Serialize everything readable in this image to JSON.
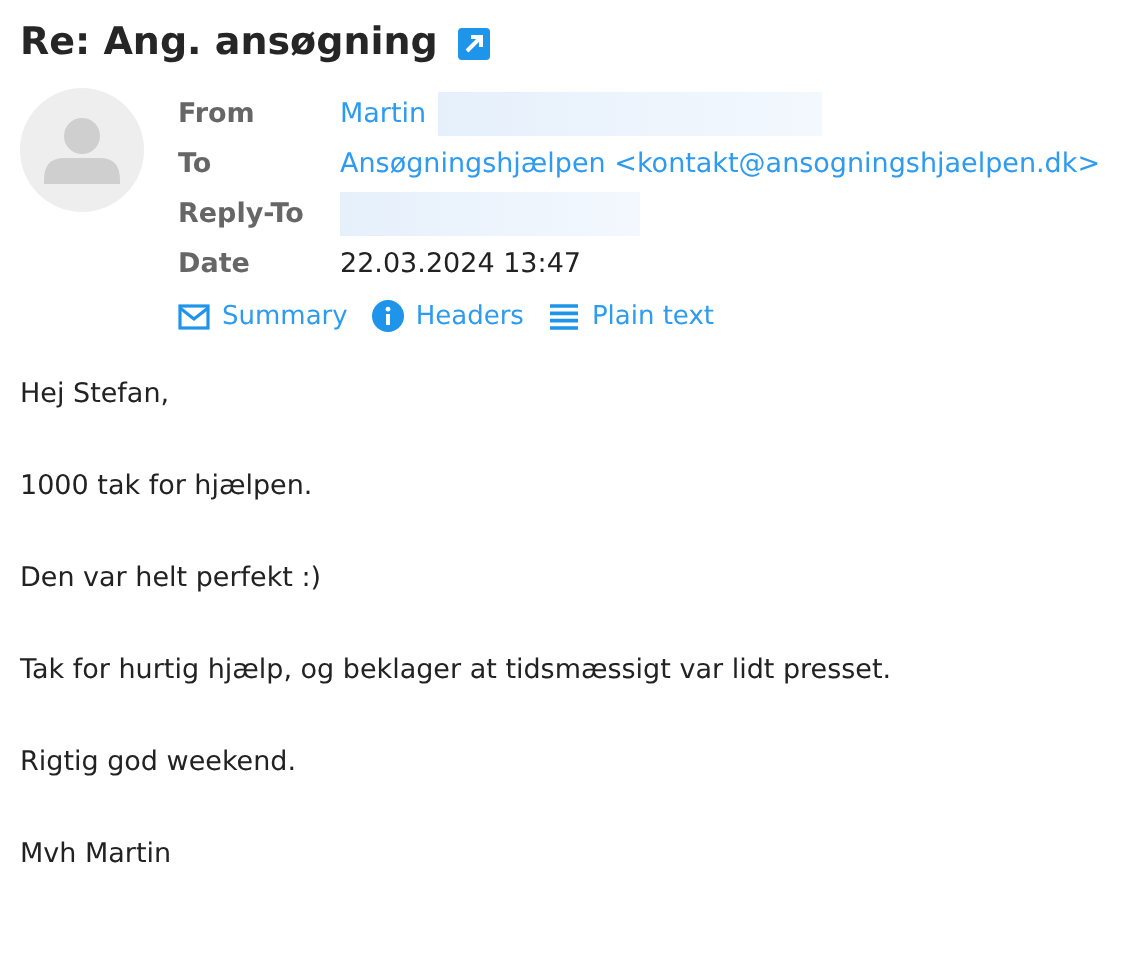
{
  "message": {
    "subject": "Re: Ang. ansøgning",
    "headers": [
      {
        "label": "From",
        "value": "Martin",
        "kind": "link",
        "redacted": true
      },
      {
        "label": "To",
        "value": "Ansøgningshjælpen <kontakt@ansogningshjaelpen.dk>",
        "kind": "link",
        "redacted": false
      },
      {
        "label": "Reply-To",
        "redacted": true
      },
      {
        "label": "Date",
        "value": "22.03.2024 13:47",
        "kind": "text",
        "redacted": false
      }
    ],
    "view_links": [
      {
        "label": "Summary",
        "kind": "envelope"
      },
      {
        "label": "Headers",
        "kind": "info"
      },
      {
        "label": "Plain text",
        "kind": "lines"
      }
    ],
    "body": [
      "Hej Stefan,",
      "1000 tak for hjælpen.",
      "Den var helt perfekt :)",
      "Tak for hurtig hjælp, og beklager at tidsmæssigt var lidt presset.",
      "Rigtig god weekend.",
      "Mvh Martin"
    ]
  }
}
